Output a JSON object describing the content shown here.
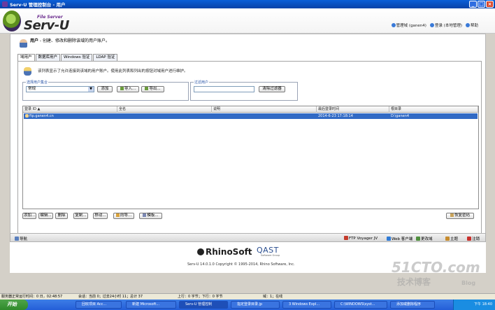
{
  "window": {
    "title": "Serv-U 管理控制台 - 用户",
    "min": "_",
    "max": "□",
    "close": "×"
  },
  "logo": {
    "file_server": "File Server",
    "serv_u": "Serv-U"
  },
  "top_links": {
    "manage_domain": "管理域 (ganen4)",
    "login": "登录 (本地管理)",
    "help": "帮助"
  },
  "page": {
    "title": "用户",
    "description": " - 创建、修改和删除该域的用户账户。"
  },
  "tabs": [
    {
      "label": "域用户"
    },
    {
      "label": "数据库用户"
    },
    {
      "label": "Windows 验证"
    },
    {
      "label": "LDAP 验证"
    }
  ],
  "hint": "该列表显示了允许连接到该域的用户账户。使用此列表和列出的按钮对域用户进行维护。",
  "user_collection": {
    "legend": "选择用户集合",
    "value": "常规",
    "add": "添加",
    "import": "导入...",
    "export": "导出..."
  },
  "filter": {
    "legend": "过滤用户",
    "value": "",
    "clear": "清除过滤器"
  },
  "table": {
    "columns": [
      "登录 ID",
      "全名",
      "说明",
      "最后登录时间",
      "根目录"
    ],
    "rows": [
      {
        "login_id": "ftp.ganen4.cn",
        "full_name": "",
        "description": "",
        "last_login": "2014-6-23 17:18:14",
        "root": "D:\\ganen4"
      }
    ]
  },
  "actions": {
    "add": "添加...",
    "edit": "编辑...",
    "delete": "删除",
    "copy": "复制...",
    "move": "移动...",
    "wizard": "向导...",
    "template": "模板...",
    "recover": "恢复密码"
  },
  "navbar": {
    "nav": "导航",
    "ftp_voyager": "FTP Voyager JV",
    "web_client": "Web 客户端",
    "change_domain": "更改域",
    "theme": "主题",
    "logout": "注销"
  },
  "footer": {
    "rhino": "RhinoSoft",
    "qast": "QAST",
    "qast_sub": "Software Group",
    "copyright": "Serv-U 14.0.1.0 Copyright © 1995-2014, Rhino Software, Inc."
  },
  "statusbar": {
    "uptime": "服务器正常运行时间：0 日，02:48:57",
    "sessions": "会话：当前 0；过去24小时 11；总计 37",
    "upload": "上行：0 字节；下行：0 字节",
    "domains": "域：1；在线"
  },
  "taskbar": {
    "start": "开始",
    "items": [
      "回收项目 Acc...",
      "新建 Microsoft...",
      "Serv-U 管理控制",
      "指定登录目录.jp",
      "3 Windows Expl...",
      "C:\\WINDOWS\\syst...",
      "添加或删除程序"
    ],
    "clock": "下午 18:40"
  },
  "watermark": {
    "site": "51CTO.com",
    "cn": "技术博客",
    "blog": "Blog"
  }
}
